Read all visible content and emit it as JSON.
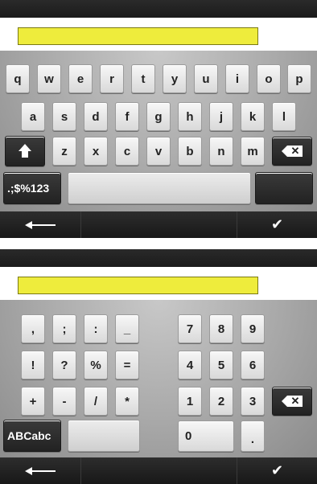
{
  "keyboard_alpha": {
    "row1": [
      "q",
      "w",
      "e",
      "r",
      "t",
      "y",
      "u",
      "i",
      "o",
      "p"
    ],
    "row2": [
      "a",
      "s",
      "d",
      "f",
      "g",
      "h",
      "j",
      "k",
      "l"
    ],
    "row3": [
      "z",
      "x",
      "c",
      "v",
      "b",
      "n",
      "m"
    ],
    "mode_label": ".;$%123",
    "text_field_color": "#eeec3c"
  },
  "keyboard_symbols": {
    "sym_row1": [
      ",",
      ";",
      ":",
      "_"
    ],
    "sym_row2": [
      "!",
      "?",
      "%",
      "="
    ],
    "sym_row3": [
      "+",
      "-",
      "/",
      "*"
    ],
    "num_row1": [
      "7",
      "8",
      "9"
    ],
    "num_row2": [
      "4",
      "5",
      "6"
    ],
    "num_row3": [
      "1",
      "2",
      "3"
    ],
    "zero": "0",
    "dot": ".",
    "mode_label": "ABCabc"
  },
  "icons": {
    "shift": "shift-icon",
    "backspace": "backspace-icon",
    "back": "back-arrow-icon",
    "confirm": "checkmark-icon"
  },
  "bottom_bar": {
    "confirm_glyph": "✔"
  }
}
